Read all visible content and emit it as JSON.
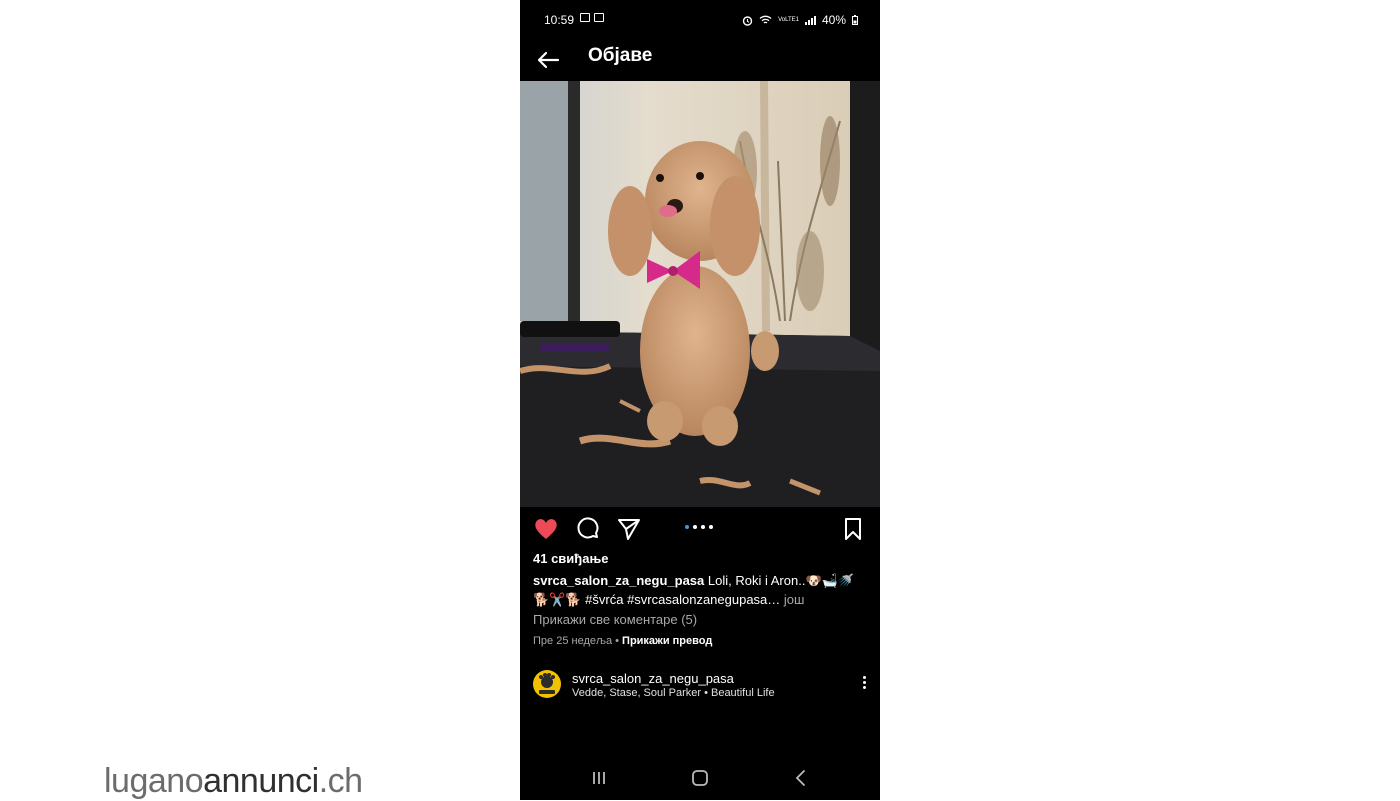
{
  "status_bar": {
    "time": "10:59",
    "battery": "40%",
    "network": "VoLTE1"
  },
  "header": {
    "title": "Објаве"
  },
  "post": {
    "likes": "41 свиђање",
    "username": "svrca_salon_za_negu_pasa",
    "caption_text": " Loli, Roki i Aron..🐶🛁🚿",
    "caption_line2": "🐕✂️🐕 #švrća #svrcasalonzanegupasa…",
    "more_label": " још",
    "view_comments": "Прикажи све коментаре (5)",
    "time_ago": "Пре 25 недеља",
    "separator": " • ",
    "translate": "Прикажи превод"
  },
  "next_post": {
    "username": "svrca_salon_za_negu_pasa",
    "music": "Vedde, Stase, Soul Parker • Beautiful Life"
  },
  "watermark": {
    "part1": "lugano",
    "part2": "annunci",
    "part3": ".ch"
  },
  "colors": {
    "like": "#ed4956",
    "dot_active": "#3897f0",
    "avatar": "#f2c200"
  }
}
